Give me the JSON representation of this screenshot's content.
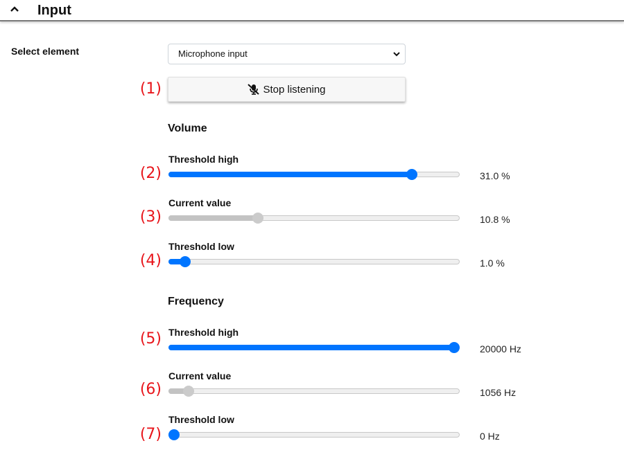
{
  "header": {
    "title": "Input",
    "collapse_icon": "chevron-up-icon"
  },
  "select_element": {
    "label": "Select element",
    "selected": "Microphone input"
  },
  "listen_button": {
    "label": "Stop listening",
    "icon": "microphone-slash-icon"
  },
  "markers": [
    "(1)",
    "(2)",
    "(3)",
    "(4)",
    "(5)",
    "(6)",
    "(7)"
  ],
  "volume": {
    "title": "Volume",
    "sliders": [
      {
        "label": "Threshold high",
        "value_text": "31.0 %",
        "fraction": 0.85,
        "state": "active"
      },
      {
        "label": "Current value",
        "value_text": "10.8 %",
        "fraction": 0.3,
        "state": "disabled"
      },
      {
        "label": "Threshold low",
        "value_text": "1.0 %",
        "fraction": 0.04,
        "state": "active"
      }
    ]
  },
  "frequency": {
    "title": "Frequency",
    "sliders": [
      {
        "label": "Threshold high",
        "value_text": "20000 Hz",
        "fraction": 1.0,
        "state": "active"
      },
      {
        "label": "Current value",
        "value_text": "1056 Hz",
        "fraction": 0.053,
        "state": "disabled"
      },
      {
        "label": "Threshold low",
        "value_text": "0 Hz",
        "fraction": 0.0,
        "state": "active"
      }
    ]
  },
  "colors": {
    "accent": "#0075ff",
    "marker": "#e8151b",
    "disabled": "#c3c3c3"
  }
}
